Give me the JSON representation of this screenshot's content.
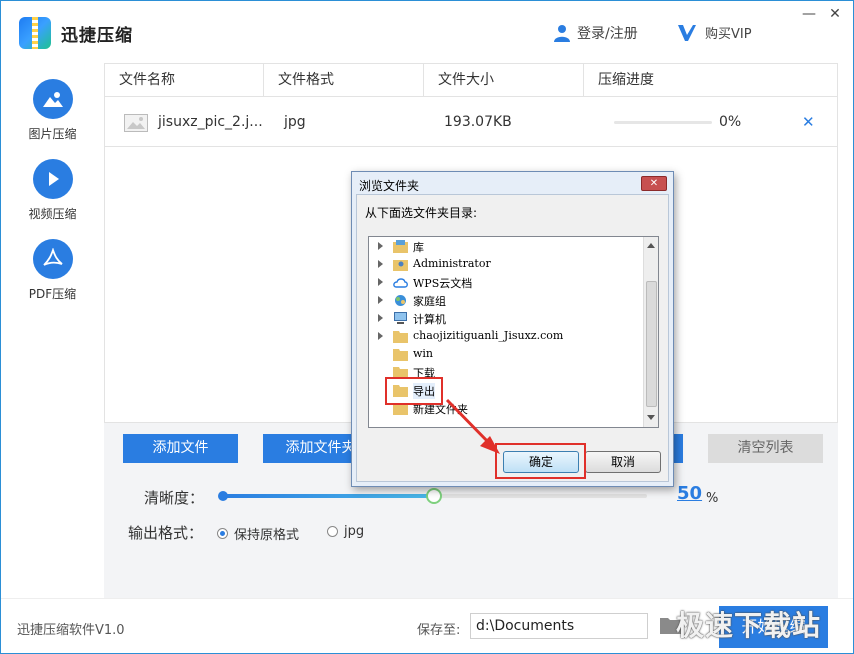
{
  "header": {
    "app_title": "迅捷压缩",
    "login_label": "登录/注册",
    "vip_label": "购买VIP",
    "minimize": "—",
    "close": "✕"
  },
  "sidebar": {
    "items": [
      {
        "label": "图片压缩",
        "icon": "image-icon",
        "active": true
      },
      {
        "label": "视频压缩",
        "icon": "play-icon"
      },
      {
        "label": "PDF压缩",
        "icon": "pdf-icon"
      }
    ]
  },
  "table": {
    "columns": [
      "文件名称",
      "文件格式",
      "文件大小",
      "压缩进度"
    ],
    "rows": [
      {
        "name": "jisuxz_pic_2.j...",
        "format": "jpg",
        "size": "193.07KB",
        "progress_text": "0%",
        "progress": 0,
        "remove": "✕"
      }
    ]
  },
  "buttons": {
    "add_file": "添加文件",
    "add_folder": "添加文件夹",
    "clear_list": "清空列表"
  },
  "settings": {
    "clarity_label": "清晰度：",
    "clarity_value": "50",
    "clarity_unit": "%",
    "clarity_fraction": 0.5,
    "format_label": "输出格式：",
    "format_options": [
      {
        "label": "保持原格式",
        "selected": true
      },
      {
        "label": "jpg",
        "selected": false
      }
    ]
  },
  "footer": {
    "version": "迅捷压缩软件V1.0",
    "save_label": "保存至:",
    "save_path": "d:\\Documents",
    "start_label": "开始压缩"
  },
  "watermark": "极速下载站",
  "dialog": {
    "title": "浏览文件夹",
    "close": "✕",
    "prompt": "从下面选文件夹目录:",
    "tree": [
      {
        "label": "库",
        "expandable": true,
        "icon": "library-icon"
      },
      {
        "label": "Administrator",
        "expandable": true,
        "icon": "user-folder-icon"
      },
      {
        "label": "WPS云文档",
        "expandable": true,
        "icon": "cloud-icon"
      },
      {
        "label": "家庭组",
        "expandable": true,
        "icon": "homegroup-icon"
      },
      {
        "label": "计算机",
        "expandable": true,
        "icon": "computer-icon"
      },
      {
        "label": "chaojizitiguanli_Jisuxz.com",
        "expandable": true,
        "icon": "folder-icon"
      },
      {
        "label": "win",
        "expandable": false,
        "icon": "folder-icon"
      },
      {
        "label": "下载",
        "expandable": false,
        "icon": "folder-icon"
      },
      {
        "label": "导出",
        "expandable": false,
        "icon": "folder-icon",
        "selected": true
      },
      {
        "label": "新建文件夹",
        "expandable": false,
        "icon": "folder-icon"
      }
    ],
    "ok_label": "确定",
    "cancel_label": "取消"
  },
  "colors": {
    "accent": "#2a7de1",
    "highlight": "#e0302a"
  }
}
